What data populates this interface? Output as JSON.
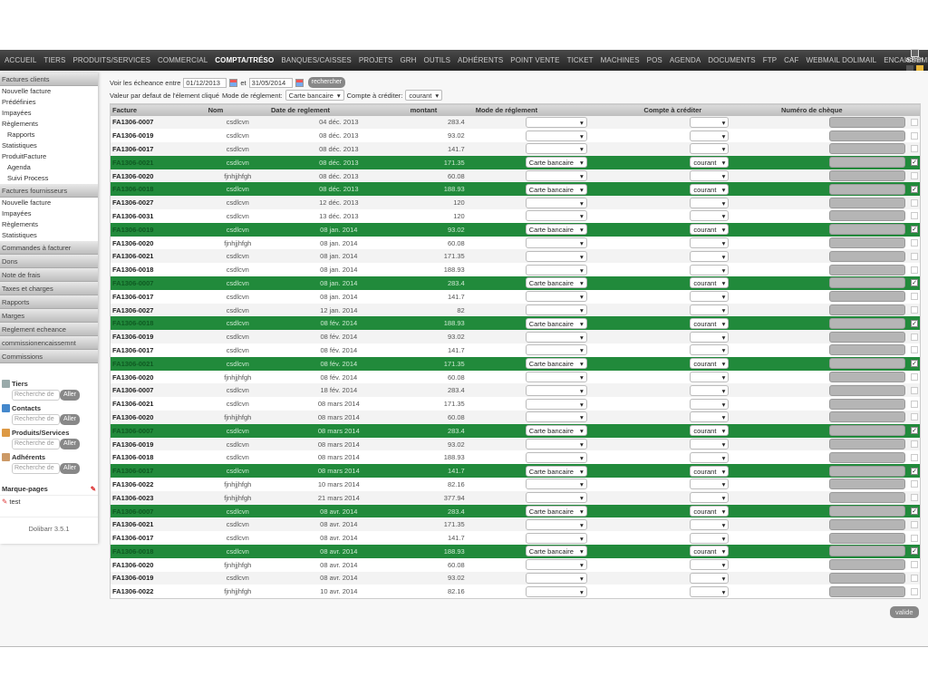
{
  "nav": {
    "items": [
      "ACCUEIL",
      "TIERS",
      "PRODUITS/SERVICES",
      "COMMERCIAL",
      "COMPTA/TRÉSO",
      "BANQUES/CAISSES",
      "PROJETS",
      "GRH",
      "OUTILS",
      "ADHÉRENTS",
      "POINT VENTE",
      "TICKET",
      "MACHINES",
      "POS",
      "AGENDA",
      "DOCUMENTS",
      "FTP",
      "CAF",
      "WEBMAIL DOLIMAIL",
      "ENCAISSEMENT"
    ],
    "active": "COMPTA/TRÉSO",
    "user": "admin"
  },
  "sidebar": {
    "groups": [
      {
        "title": "Factures clients",
        "items": [
          {
            "label": "Nouvelle facture"
          },
          {
            "label": "Prédéfinies"
          },
          {
            "label": "Impayées"
          },
          {
            "label": "Règlements"
          },
          {
            "label": "Rapports",
            "sub": true
          },
          {
            "label": "Statistiques"
          },
          {
            "label": "ProduitFacture"
          },
          {
            "label": "Agenda",
            "sub": true
          },
          {
            "label": "Suivi Process",
            "sub": true
          }
        ]
      },
      {
        "title": "Factures fournisseurs",
        "items": [
          {
            "label": "Nouvelle facture"
          },
          {
            "label": "Impayées"
          },
          {
            "label": "Règlements"
          },
          {
            "label": "Statistiques"
          }
        ]
      },
      {
        "title": "Commandes à facturer",
        "items": []
      },
      {
        "title": "Dons",
        "items": []
      },
      {
        "title": "Note de frais",
        "items": []
      },
      {
        "title": "Taxes et charges",
        "items": []
      },
      {
        "title": "Rapports",
        "items": []
      },
      {
        "title": "Marges",
        "items": []
      },
      {
        "title": "Reglement echeance",
        "items": []
      },
      {
        "title": "commissionencaissemnt",
        "items": []
      },
      {
        "title": "Commissions",
        "items": []
      }
    ],
    "searches": [
      {
        "title": "Tiers",
        "placeholder": "Recherche de",
        "color": "#9aa"
      },
      {
        "title": "Contacts",
        "placeholder": "Recherche de",
        "color": "#48c"
      },
      {
        "title": "Produits/Services",
        "placeholder": "Recherche de",
        "color": "#d94"
      },
      {
        "title": "Adhérents",
        "placeholder": "Recherche de",
        "color": "#c96"
      }
    ],
    "go_label": "Aller",
    "bookmarks_title": "Marque-pages",
    "bookmark": "test",
    "version": "Dolibarr 3.5.1"
  },
  "filter": {
    "label": "Voir les écheance entre",
    "from": "01/12/2013",
    "and": "et",
    "to": "31/05/2014",
    "search": "rechercher",
    "default_label": "Valeur par defaut de l'élement cliqué",
    "mode_label": "Mode de réglement:",
    "mode_value": "Carte bancaire",
    "compte_label": "Compte à créditer:",
    "compte_value": "courant"
  },
  "table": {
    "headers": [
      "Facture",
      "Nom",
      "Date de reglement",
      "montant",
      "Mode de réglement",
      "Compte à créditer",
      "Numéro de chèque"
    ],
    "checked_mode": "Carte bancaire",
    "checked_compte": "courant",
    "rows": [
      [
        "FA1306-0007",
        "csdlcvn",
        "04 déc. 2013",
        "283.4",
        0
      ],
      [
        "FA1306-0019",
        "csdlcvn",
        "08 déc. 2013",
        "93.02",
        0
      ],
      [
        "FA1306-0017",
        "csdlcvn",
        "08 déc. 2013",
        "141.7",
        0
      ],
      [
        "FA1306-0021",
        "csdlcvn",
        "08 déc. 2013",
        "171.35",
        1
      ],
      [
        "FA1306-0020",
        "fjnhjjhfgh",
        "08 déc. 2013",
        "60.08",
        0
      ],
      [
        "FA1306-0018",
        "csdlcvn",
        "08 déc. 2013",
        "188.93",
        1
      ],
      [
        "FA1306-0027",
        "csdlcvn",
        "12 déc. 2013",
        "120",
        0
      ],
      [
        "FA1306-0031",
        "csdlcvn",
        "13 déc. 2013",
        "120",
        0
      ],
      [
        "FA1306-0019",
        "csdlcvn",
        "08 jan. 2014",
        "93.02",
        1
      ],
      [
        "FA1306-0020",
        "fjnhjjhfgh",
        "08 jan. 2014",
        "60.08",
        0
      ],
      [
        "FA1306-0021",
        "csdlcvn",
        "08 jan. 2014",
        "171.35",
        0
      ],
      [
        "FA1306-0018",
        "csdlcvn",
        "08 jan. 2014",
        "188.93",
        0
      ],
      [
        "FA1306-0007",
        "csdlcvn",
        "08 jan. 2014",
        "283.4",
        1
      ],
      [
        "FA1306-0017",
        "csdlcvn",
        "08 jan. 2014",
        "141.7",
        0
      ],
      [
        "FA1306-0027",
        "csdlcvn",
        "12 jan. 2014",
        "82",
        0
      ],
      [
        "FA1306-0018",
        "csdlcvn",
        "08 fév. 2014",
        "188.93",
        1
      ],
      [
        "FA1306-0019",
        "csdlcvn",
        "08 fév. 2014",
        "93.02",
        0
      ],
      [
        "FA1306-0017",
        "csdlcvn",
        "08 fév. 2014",
        "141.7",
        0
      ],
      [
        "FA1306-0021",
        "csdlcvn",
        "08 fév. 2014",
        "171.35",
        1
      ],
      [
        "FA1306-0020",
        "fjnhjjhfgh",
        "08 fév. 2014",
        "60.08",
        0
      ],
      [
        "FA1306-0007",
        "csdlcvn",
        "18 fév. 2014",
        "283.4",
        0
      ],
      [
        "FA1306-0021",
        "csdlcvn",
        "08 mars 2014",
        "171.35",
        0
      ],
      [
        "FA1306-0020",
        "fjnhjjhfgh",
        "08 mars 2014",
        "60.08",
        0
      ],
      [
        "FA1306-0007",
        "csdlcvn",
        "08 mars 2014",
        "283.4",
        1
      ],
      [
        "FA1306-0019",
        "csdlcvn",
        "08 mars 2014",
        "93.02",
        0
      ],
      [
        "FA1306-0018",
        "csdlcvn",
        "08 mars 2014",
        "188.93",
        0
      ],
      [
        "FA1306-0017",
        "csdlcvn",
        "08 mars 2014",
        "141.7",
        1
      ],
      [
        "FA1306-0022",
        "fjnhjjhfgh",
        "10 mars 2014",
        "82.16",
        0
      ],
      [
        "FA1306-0023",
        "fjnhjjhfgh",
        "21 mars 2014",
        "377.94",
        0
      ],
      [
        "FA1306-0007",
        "csdlcvn",
        "08 avr. 2014",
        "283.4",
        1
      ],
      [
        "FA1306-0021",
        "csdlcvn",
        "08 avr. 2014",
        "171.35",
        0
      ],
      [
        "FA1306-0017",
        "csdlcvn",
        "08 avr. 2014",
        "141.7",
        0
      ],
      [
        "FA1306-0018",
        "csdlcvn",
        "08 avr. 2014",
        "188.93",
        1
      ],
      [
        "FA1306-0020",
        "fjnhjjhfgh",
        "08 avr. 2014",
        "60.08",
        0
      ],
      [
        "FA1306-0019",
        "csdlcvn",
        "08 avr. 2014",
        "93.02",
        0
      ],
      [
        "FA1306-0022",
        "fjnhjjhfgh",
        "10 avr. 2014",
        "82.16",
        0
      ]
    ]
  },
  "valide_label": "valide",
  "colors": {
    "highlight": "#218a3b"
  }
}
